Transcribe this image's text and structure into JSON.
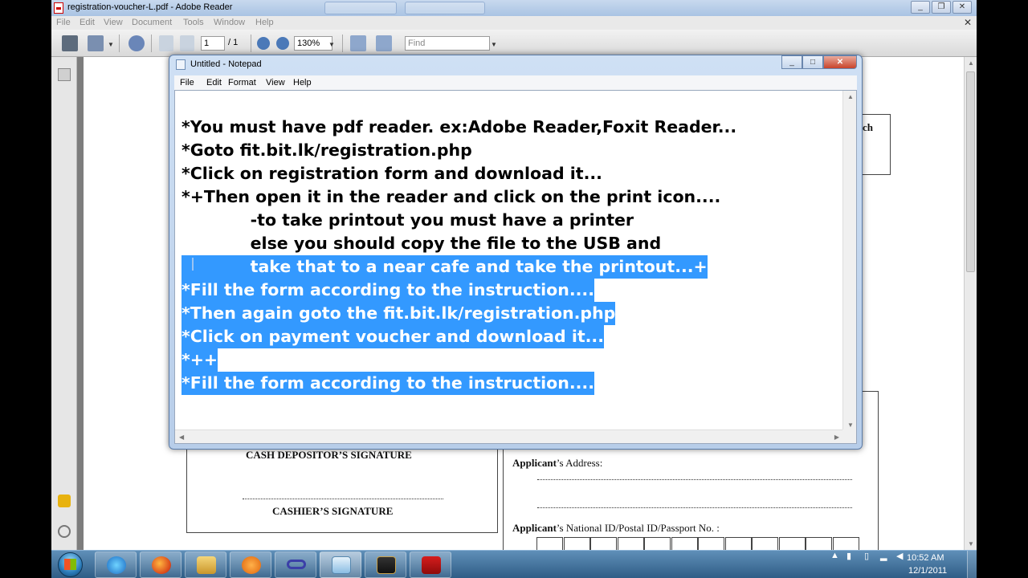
{
  "reader": {
    "title": "registration-voucher-L.pdf - Adobe Reader",
    "menu": [
      "File",
      "Edit",
      "View",
      "Document",
      "Tools",
      "Window",
      "Help"
    ],
    "toolbar": {
      "page_current": "1",
      "page_total": "/ 1",
      "zoom": "130%",
      "find_placeholder": "Find"
    },
    "page": {
      "partial_right_text": "ch",
      "cash_depositor_signature": "CASH DEPOSITOR’S SIGNATURE",
      "cashier_signature": "CASHIER’S SIGNATURE",
      "applicant_address_bold": "Applicant",
      "applicant_address_rest": "’s Address:",
      "applicant_id_bold": "Applicant",
      "applicant_id_rest": "’s National ID/Postal ID/Passport No. :"
    }
  },
  "notepad": {
    "title": "Untitled - Notepad",
    "menu": [
      "File",
      "Edit",
      "Format",
      "View",
      "Help"
    ],
    "lines": [
      {
        "text": "*You must have pdf reader. ex:Adobe Reader,Foxit Reader...",
        "selected": false
      },
      {
        "text": "*Goto fit.bit.lk/registration.php",
        "selected": false
      },
      {
        "text": "*Click on registration form and download it...",
        "selected": false
      },
      {
        "text": "*+Then open it in the reader and click on the print icon....",
        "selected": false
      },
      {
        "text": "            -to take printout you must have a printer",
        "selected": false
      },
      {
        "text": "            else you should copy the file to the USB and",
        "selected": false
      },
      {
        "text": "            take that to a near cafe and take the printout...+",
        "selected": true
      },
      {
        "text": "*Fill the form according to the instruction....",
        "selected": true
      },
      {
        "text": "*Then again goto the fit.bit.lk/registration.php",
        "selected": true
      },
      {
        "text": "*Click on payment voucher and download it...",
        "selected": true
      },
      {
        "text": "*++",
        "selected": true
      },
      {
        "text": "*Fill the form according to the instruction....",
        "selected": true
      }
    ]
  },
  "taskbar": {
    "apps": [
      "internet-explorer",
      "firefox",
      "windows-explorer",
      "media-player",
      "app-infinity",
      "notepad",
      "hitec-app",
      "adobe-reader"
    ],
    "clock_time": "10:52 AM",
    "clock_date": "12/1/2011"
  }
}
